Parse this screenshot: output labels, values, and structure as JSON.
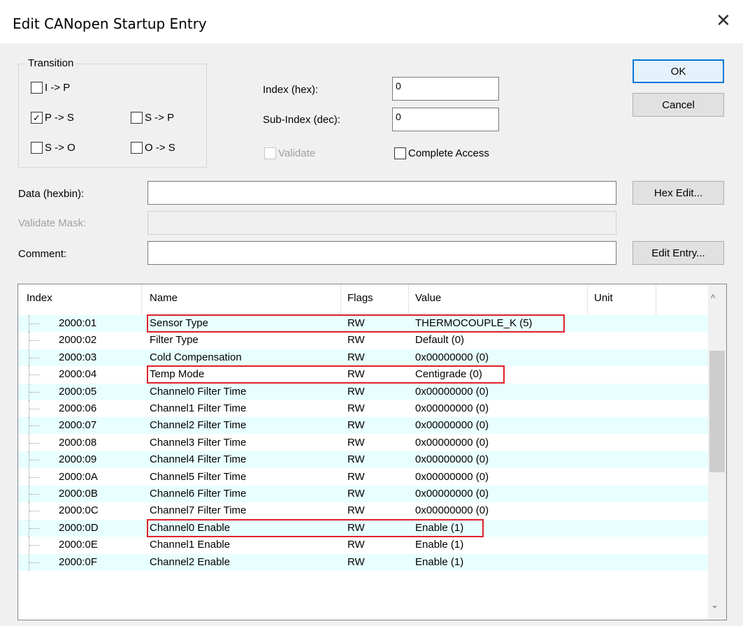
{
  "window": {
    "title": "Edit CANopen Startup Entry",
    "close_glyph": "✕"
  },
  "transition": {
    "label": "Transition",
    "items": [
      {
        "label": "I -> P",
        "checked": false
      },
      {
        "label": "P -> S",
        "checked": true
      },
      {
        "label": "S -> P",
        "checked": false
      },
      {
        "label": "S -> O",
        "checked": false
      },
      {
        "label": "O -> S",
        "checked": false
      }
    ]
  },
  "index": {
    "label": "Index (hex):",
    "value": "0"
  },
  "subindex": {
    "label": "Sub-Index (dec):",
    "value": "0"
  },
  "validate": {
    "label": "Validate",
    "checked": false
  },
  "complete_access": {
    "label": "Complete Access",
    "checked": false
  },
  "buttons": {
    "ok": "OK",
    "cancel": "Cancel",
    "hex_edit": "Hex Edit...",
    "edit_entry": "Edit Entry..."
  },
  "fields": {
    "data_label": "Data (hexbin):",
    "data_value": "",
    "mask_label": "Validate Mask:",
    "mask_value": "",
    "comment_label": "Comment:",
    "comment_value": ""
  },
  "table": {
    "columns": [
      "Index",
      "Name",
      "Flags",
      "Value",
      "Unit"
    ],
    "rows": [
      {
        "index": "2000:01",
        "name": "Sensor Type",
        "flags": "RW",
        "value": "THERMOCOUPLE_K (5)",
        "highlighted": true
      },
      {
        "index": "2000:02",
        "name": "Filter Type",
        "flags": "RW",
        "value": "Default (0)",
        "highlighted": false
      },
      {
        "index": "2000:03",
        "name": "Cold Compensation",
        "flags": "RW",
        "value": "0x00000000 (0)",
        "highlighted": false
      },
      {
        "index": "2000:04",
        "name": "Temp Mode",
        "flags": "RW",
        "value": "Centigrade (0)",
        "highlighted": true
      },
      {
        "index": "2000:05",
        "name": "Channel0 Filter Time",
        "flags": "RW",
        "value": "0x00000000 (0)",
        "highlighted": false
      },
      {
        "index": "2000:06",
        "name": "Channel1 Filter Time",
        "flags": "RW",
        "value": "0x00000000 (0)",
        "highlighted": false
      },
      {
        "index": "2000:07",
        "name": "Channel2 Filter Time",
        "flags": "RW",
        "value": "0x00000000 (0)",
        "highlighted": false
      },
      {
        "index": "2000:08",
        "name": "Channel3 Filter Time",
        "flags": "RW",
        "value": "0x00000000 (0)",
        "highlighted": false
      },
      {
        "index": "2000:09",
        "name": "Channel4 Filter Time",
        "flags": "RW",
        "value": "0x00000000 (0)",
        "highlighted": false
      },
      {
        "index": "2000:0A",
        "name": "Channel5 Filter Time",
        "flags": "RW",
        "value": "0x00000000 (0)",
        "highlighted": false
      },
      {
        "index": "2000:0B",
        "name": "Channel6 Filter Time",
        "flags": "RW",
        "value": "0x00000000 (0)",
        "highlighted": false
      },
      {
        "index": "2000:0C",
        "name": "Channel7 Filter Time",
        "flags": "RW",
        "value": "0x00000000 (0)",
        "highlighted": false
      },
      {
        "index": "2000:0D",
        "name": "Channel0 Enable",
        "flags": "RW",
        "value": "Enable (1)",
        "highlighted": true
      },
      {
        "index": "2000:0E",
        "name": "Channel1 Enable",
        "flags": "RW",
        "value": "Enable (1)",
        "highlighted": false
      },
      {
        "index": "2000:0F",
        "name": "Channel2 Enable",
        "flags": "RW",
        "value": "Enable (1)",
        "highlighted": false
      }
    ]
  },
  "scrollbar": {
    "up_glyph": "^",
    "down_glyph": "⌄"
  },
  "colors": {
    "row_alt": "#e8ffff",
    "highlight": "#e0202a",
    "default_button": "#0078d7"
  }
}
